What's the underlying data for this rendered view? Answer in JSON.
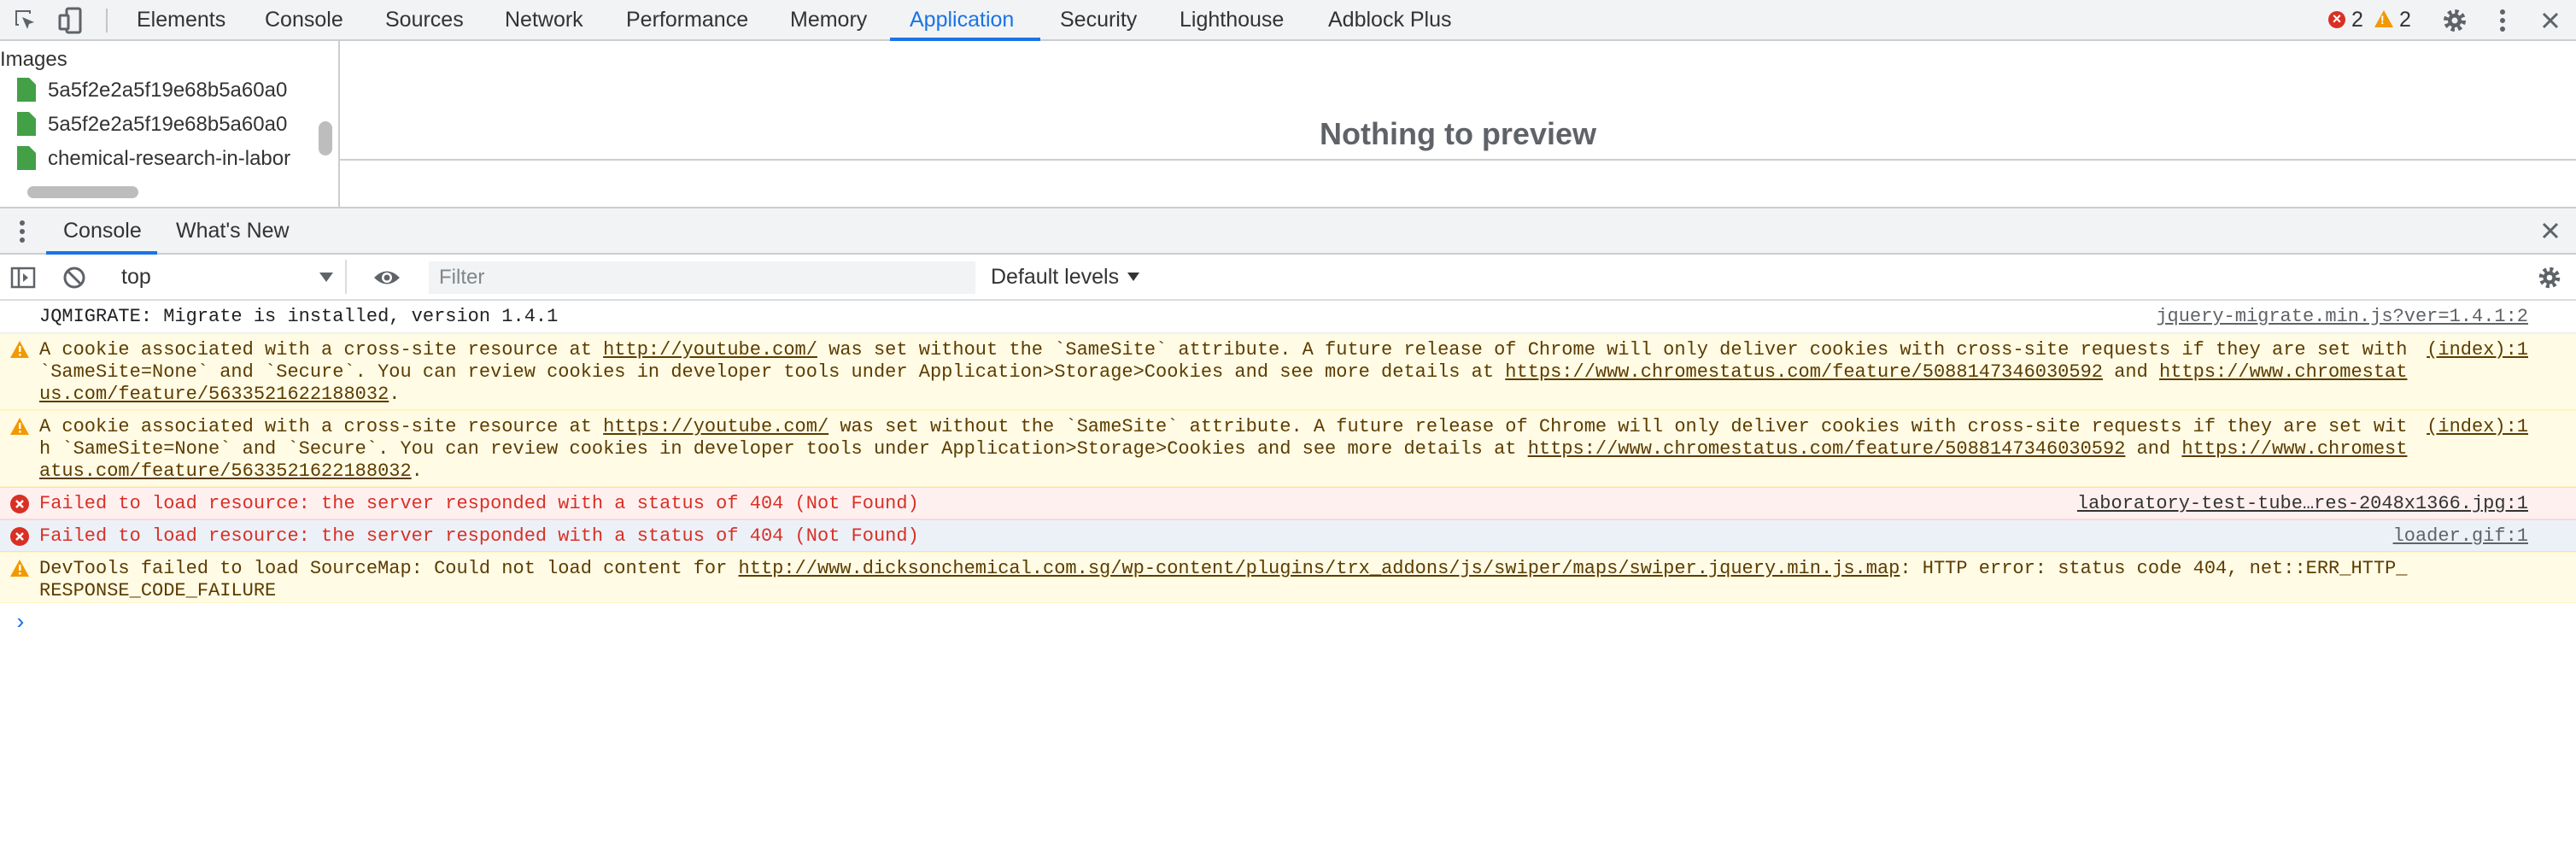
{
  "tabs": [
    {
      "label": "Elements"
    },
    {
      "label": "Console"
    },
    {
      "label": "Sources"
    },
    {
      "label": "Network"
    },
    {
      "label": "Performance"
    },
    {
      "label": "Memory"
    },
    {
      "label": "Application"
    },
    {
      "label": "Security"
    },
    {
      "label": "Lighthouse"
    },
    {
      "label": "Adblock Plus"
    }
  ],
  "active_tab": "Application",
  "status": {
    "errors": "2",
    "warnings": "2"
  },
  "sidebar": {
    "group_label": "Images",
    "files": [
      {
        "name": "5a5f2e2a5f19e68b5a60a0"
      },
      {
        "name": "5a5f2e2a5f19e68b5a60a0"
      },
      {
        "name": "chemical-research-in-labor"
      }
    ]
  },
  "preview": {
    "empty_text": "Nothing to preview"
  },
  "drawer": {
    "tabs": [
      {
        "label": "Console"
      },
      {
        "label": "What's New"
      }
    ]
  },
  "console_toolbar": {
    "context": "top",
    "filter_placeholder": "Filter",
    "levels_label": "Default levels"
  },
  "messages": [
    {
      "level": "info",
      "text": "JQMIGRATE: Migrate is installed, version 1.4.1",
      "source": "jquery-migrate.min.js?ver=1.4.1:2"
    },
    {
      "level": "warning",
      "parts": [
        {
          "t": "A cookie associated with a cross-site resource at "
        },
        {
          "t": "http://youtube.com/",
          "link": true
        },
        {
          "t": " was set without the `SameSite` attribute. A future release of Chrome will only deliver cookies with cross-site requests if they are set with `SameSite=None` and `Secure`. You can review cookies in developer tools under Application>Storage>Cookies and see more details at "
        },
        {
          "t": "https://www.chromestatus.com/feature/5088147346030592",
          "link": true
        },
        {
          "t": " and "
        },
        {
          "t": "https://www.chromestatus.com/feature/5633521622188032",
          "link": true
        },
        {
          "t": "."
        }
      ],
      "source": "(index):1"
    },
    {
      "level": "warning",
      "parts": [
        {
          "t": "A cookie associated with a cross-site resource at "
        },
        {
          "t": "https://youtube.com/",
          "link": true
        },
        {
          "t": " was set without the `SameSite` attribute. A future release of Chrome will only deliver cookies with cross-site requests if they are set with `SameSite=None` and `Secure`. You can review cookies in developer tools under Application>Storage>Cookies and see more details at "
        },
        {
          "t": "https://www.chromestatus.com/feature/5088147346030592",
          "link": true
        },
        {
          "t": " and "
        },
        {
          "t": "https://www.chromestatus.com/feature/5633521622188032",
          "link": true
        },
        {
          "t": "."
        }
      ],
      "source": "(index):1"
    },
    {
      "level": "error",
      "text": "Failed to load resource: the server responded with a status of 404 (Not Found)",
      "source": "laboratory-test-tube…res-2048x1366.jpg:1"
    },
    {
      "level": "error",
      "text": "Failed to load resource: the server responded with a status of 404 (Not Found)",
      "source": "loader.gif:1"
    },
    {
      "level": "warning",
      "parts": [
        {
          "t": "DevTools failed to load SourceMap: Could not load content for "
        },
        {
          "t": "http://www.dicksonchemical.com.sg/wp-content/plugins/trx_addons/js/swiper/maps/swiper.jquery.min.js.map",
          "link": true
        },
        {
          "t": ": HTTP error: status code 404, net::ERR_HTTP_RESPONSE_CODE_FAILURE"
        }
      ],
      "source": ""
    }
  ],
  "colors": {
    "accent": "#1a73e8",
    "error": "#d93025",
    "warning": "#f29900",
    "warning_bg": "#fffbe5",
    "error_bg": "#fff0f0",
    "toolbar_bg": "#f1f3f4"
  },
  "icons": {
    "inspect": "inspect-element-icon",
    "device": "device-toolbar-icon",
    "settings": "gear-icon",
    "menu": "kebab-menu-icon",
    "close": "close-icon",
    "sidebar_toggle": "show-sidebar-icon",
    "clear": "clear-console-icon",
    "eye": "live-expression-eye-icon"
  }
}
